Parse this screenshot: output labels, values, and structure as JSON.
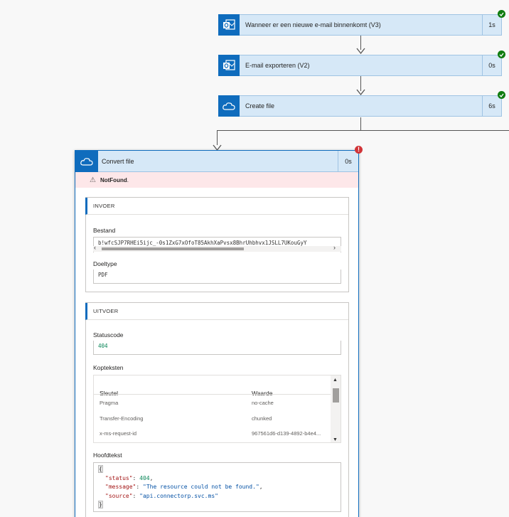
{
  "steps": [
    {
      "title": "Wanneer er een nieuwe e-mail binnenkomt (V3)",
      "duration": "1s",
      "icon": "outlook-icon"
    },
    {
      "title": "E-mail exporteren (V2)",
      "duration": "0s",
      "icon": "outlook-icon"
    },
    {
      "title": "Create file",
      "duration": "6s",
      "icon": "onedrive-icon"
    }
  ],
  "card": {
    "title": "Convert file",
    "duration": "0s",
    "icon": "onedrive-icon",
    "error": "NotFound",
    "error_suffix": ".",
    "inputs": {
      "header": "INVOER",
      "file_label": "Bestand",
      "file_value": "b!wfcSJP7RHEi5ijc_-0s1ZxG7xOfoT85AkhXaPvsx8BhrUhbhvx1JSLL7UKouGyY",
      "target_label": "Doeltype",
      "target_value": "PDF"
    },
    "outputs": {
      "header": "UITVOER",
      "status_label": "Statuscode",
      "status_value": "404",
      "headers_label": "Kopteksten",
      "col_key": "Sleutel",
      "col_value": "Waarde",
      "rows": [
        {
          "key": "Pragma",
          "value": "no-cache"
        },
        {
          "key": "Transfer-Encoding",
          "value": "chunked"
        },
        {
          "key": "x-ms-request-id",
          "value": "967561d6-d139-4892-b4e4..."
        }
      ],
      "body_label": "Hoofdtekst",
      "body": {
        "open": "{",
        "close": "}",
        "status_key": "\"status\"",
        "status_val": "404",
        "message_key": "\"message\"",
        "message_val": "\"The resource could not be found.\"",
        "source_key": "\"source\"",
        "source_val": "\"api.connectorp.svc.ms\""
      }
    }
  },
  "colors": {
    "accent": "#0f6cbd",
    "success": "#107c10",
    "error": "#d13438",
    "error_bg": "#fde7e9"
  }
}
